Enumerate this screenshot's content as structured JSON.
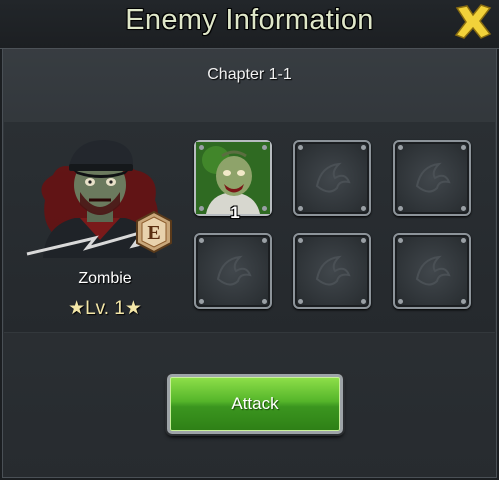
{
  "dialog": {
    "title": "Enemy Information",
    "subtitle": "Chapter 1-1"
  },
  "enemy": {
    "name": "Zombie",
    "level": "★Lv. 1★",
    "rank_badge": "E"
  },
  "drops": {
    "slots": [
      {
        "filled": true,
        "count": "1",
        "icon": "zombie-face-icon"
      },
      {
        "filled": false,
        "icon": "empty-slot-emblem-icon"
      },
      {
        "filled": false,
        "icon": "empty-slot-emblem-icon"
      },
      {
        "filled": false,
        "icon": "empty-slot-emblem-icon"
      },
      {
        "filled": false,
        "icon": "empty-slot-emblem-icon"
      },
      {
        "filled": false,
        "icon": "empty-slot-emblem-icon"
      }
    ]
  },
  "actions": {
    "attack_label": "Attack",
    "close_icon": "close-icon"
  },
  "colors": {
    "title_text": "#dfe7c9",
    "attack_button": "#55b52a",
    "close_icon": "#f2d23a",
    "level_text": "#f4e7a8"
  }
}
